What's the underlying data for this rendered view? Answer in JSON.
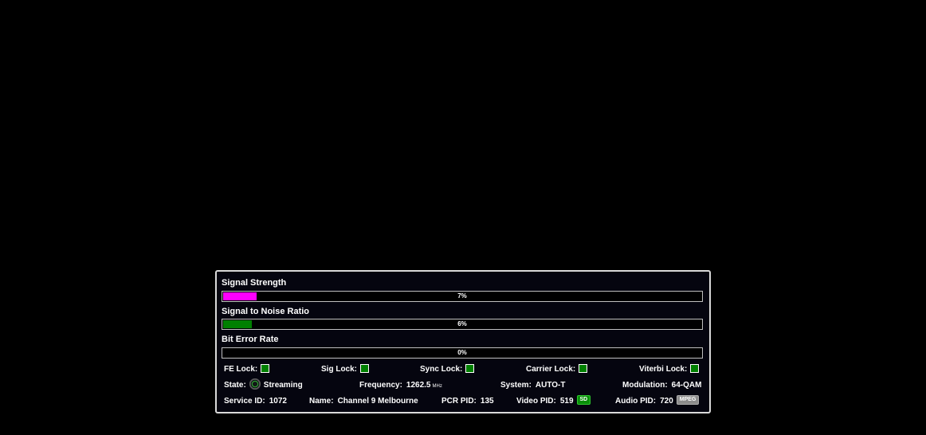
{
  "meters": [
    {
      "label": "Signal Strength",
      "value_text": "7%",
      "fraction": 0.07,
      "color": "#ff00ff"
    },
    {
      "label": "Signal to Noise Ratio",
      "value_text": "6%",
      "fraction": 0.06,
      "color": "#008000"
    },
    {
      "label": "Bit Error Rate",
      "value_text": "0%",
      "fraction": 0.0,
      "color": "#008000"
    }
  ],
  "locks": [
    {
      "label": "FE Lock:",
      "status": "locked",
      "color": "#008000"
    },
    {
      "label": "Sig Lock:",
      "status": "locked",
      "color": "#008000"
    },
    {
      "label": "Sync Lock:",
      "status": "locked",
      "color": "#008000"
    },
    {
      "label": "Carrier Lock:",
      "status": "locked",
      "color": "#008000"
    },
    {
      "label": "Viterbi Lock:",
      "status": "locked",
      "color": "#008000"
    }
  ],
  "status": {
    "state_label": "State:",
    "state_value": "Streaming",
    "state_icon": "streaming-icon",
    "frequency_label": "Frequency:",
    "frequency_value": "1262.5",
    "frequency_unit": "MHz",
    "system_label": "System:",
    "system_value": "AUTO-T",
    "modulation_label": "Modulation:",
    "modulation_value": "64-QAM"
  },
  "service": {
    "service_id_label": "Service ID:",
    "service_id_value": "1072",
    "name_label": "Name:",
    "name_value": "Channel 9 Melbourne",
    "pcr_pid_label": "PCR PID:",
    "pcr_pid_value": "135",
    "video_pid_label": "Video PID:",
    "video_pid_value": "519",
    "video_badge": "SD",
    "audio_pid_label": "Audio PID:",
    "audio_pid_value": "720",
    "audio_badge": "MPEG"
  }
}
